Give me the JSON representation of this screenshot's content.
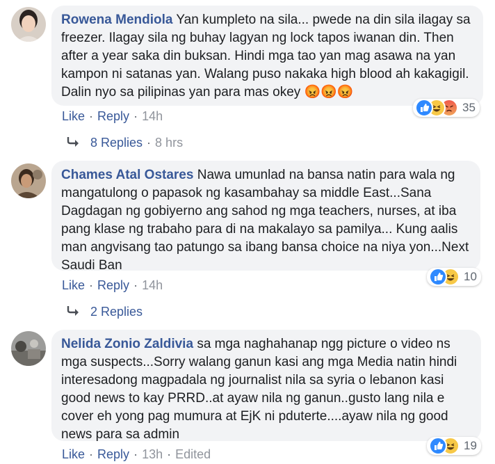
{
  "comments": [
    {
      "author": "Rowena Mendiola",
      "text": "Yan kumpleto na sila... pwede na din sila ilagay sa freezer. Ilagay sila ng buhay lagyan ng lock tapos iwanan din. Then after a year saka din buksan. Hindi mga tao yan mag asawa na yan kampon ni satanas yan. Walang puso nakaka high blood ah kakagigil. Dalin nyo sa pilipinas yan para mas okey",
      "emoji_line": "😡😡😡",
      "reaction_count": "35",
      "reaction_icons": [
        "like-icon",
        "haha-icon",
        "angry-icon"
      ],
      "like_label": "Like",
      "reply_label": "Reply",
      "time": "14h",
      "replies_label": "8 Replies",
      "replies_time": "8 hrs"
    },
    {
      "author": "Chames Atal Ostares",
      "text": "Nawa umunlad na bansa natin para wala ng mangatulong o papasok ng kasambahay sa middle East...Sana Dagdagan ng gobiyerno ang sahod ng mga teachers, nurses, at iba pang klase ng trabaho para di na makalayo sa pamilya... Kung aalis man angvisang tao patungo sa ibang bansa choice na niya yon...Next Saudi Ban",
      "reaction_count": "10",
      "reaction_icons": [
        "like-icon",
        "haha-icon"
      ],
      "like_label": "Like",
      "reply_label": "Reply",
      "time": "14h",
      "replies_label": "2 Replies"
    },
    {
      "author": "Nelida Zonio Zaldivia",
      "text": "sa mga naghahanap ngg picture o video ns mga suspects...Sorry walang ganun kasi ang mga Media natin hindi interesadong magpadala ng journalist nila sa syria o lebanon kasi good news to kay PRRD..at ayaw nila ng ganun..gusto lang nila e cover eh yong pag mumura at EjK ni pduterte....ayaw nila ng good news para sa admin",
      "reaction_count": "19",
      "reaction_icons": [
        "like-icon",
        "haha-icon"
      ],
      "like_label": "Like",
      "reply_label": "Reply",
      "time": "13h",
      "edited_label": "Edited"
    }
  ],
  "colors": {
    "link": "#385898",
    "bubble": "#f2f3f5",
    "meta": "#90949c",
    "like": "#2e89ff",
    "haha": "#f7c847",
    "angry": "#f05a4b"
  }
}
